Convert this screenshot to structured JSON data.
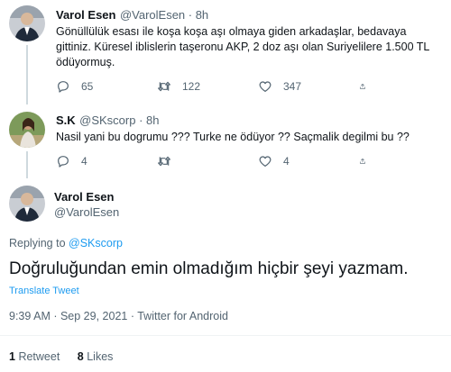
{
  "tweet1": {
    "name": "Varol Esen",
    "handle_time": "@VarolEsen · 8h",
    "text_line1": "Gönüllülük esası ile koşa koşa aşı olmaya giden arkadaşlar, bedavaya",
    "text_line2": "gittiniz. Küresel iblislerin taşeronu AKP, 2 doz aşı olan Suriyelilere 1.500 TL",
    "text_line3": "ödüyormuş.",
    "reply_count": "65",
    "retweet_count": "122",
    "like_count": "347"
  },
  "tweet2": {
    "name": "S.K",
    "handle_time": "@SKscorp · 8h",
    "text": "Nasil yani bu dogrumu ??? Turke ne ödüyor ?? Saçmalik degilmi bu ??",
    "reply_count": "4",
    "retweet_count": "",
    "like_count": "4"
  },
  "main": {
    "name": "Varol Esen",
    "handle": "@VarolEsen",
    "replying_prefix": "Replying to ",
    "replying_handle": "@SKscorp",
    "text": "Doğruluğundan emin olmadığım hiçbir şeyi yazmam.",
    "translate": "Translate Tweet",
    "timestamp": "9:39 AM · Sep 29, 2021 · Twitter for Android",
    "retweets_count": "1",
    "retweets_label": "Retweet",
    "likes_count": "8",
    "likes_label": "Likes"
  },
  "colors": {
    "accent": "#1d9bf0",
    "secondary_text": "#536471",
    "primary_text": "#0f1419"
  },
  "icons": [
    "reply-icon",
    "retweet-icon",
    "like-icon",
    "share-icon"
  ]
}
